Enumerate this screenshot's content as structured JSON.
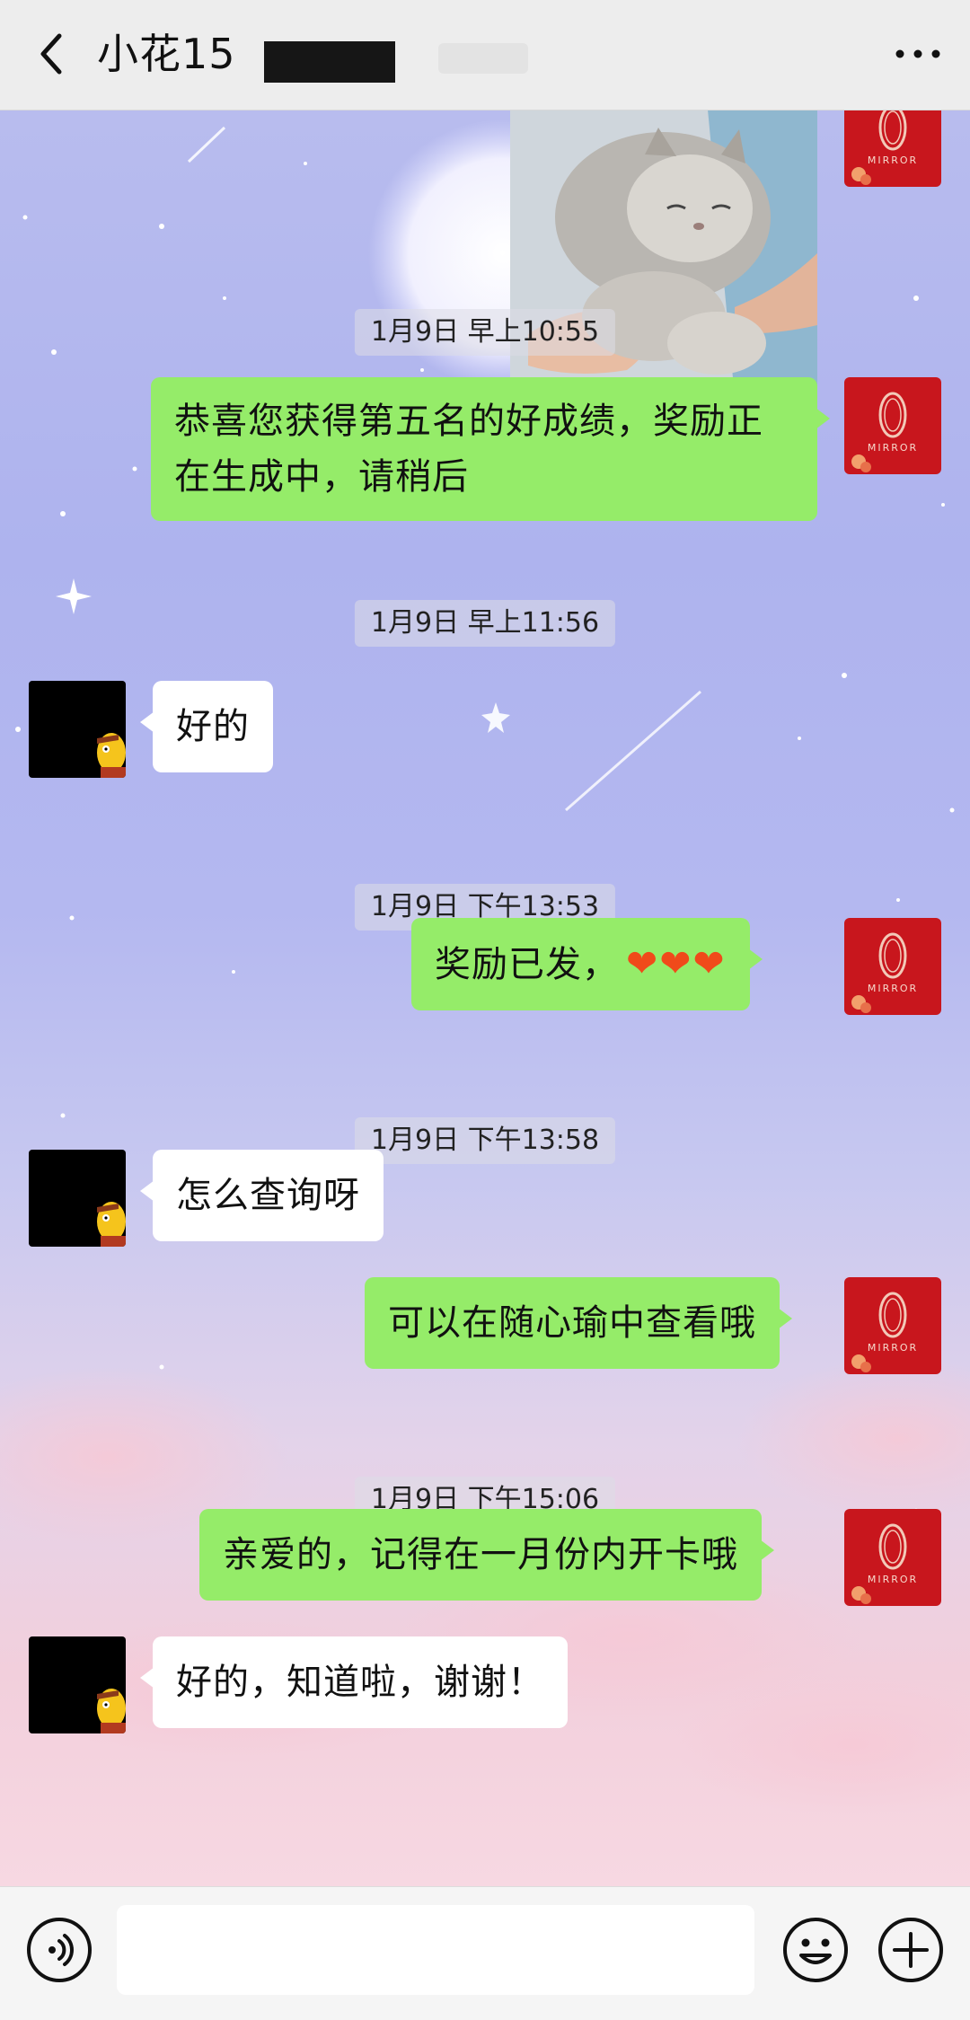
{
  "header": {
    "title": "小花15",
    "back_icon": "chevron-left-icon",
    "more_icon": "more-dots-icon"
  },
  "messages": [
    {
      "type": "image",
      "side": "right",
      "description_icon": "cat-photo"
    },
    {
      "type": "time",
      "text": "1月9日 早上10:55"
    },
    {
      "type": "text",
      "side": "right",
      "text": "恭喜您获得第五名的好成绩，奖励正在生成中，请稍后"
    },
    {
      "type": "time",
      "text": "1月9日 早上11:56"
    },
    {
      "type": "text",
      "side": "left",
      "text": "好的"
    },
    {
      "type": "time",
      "text": "1月9日 下午13:53"
    },
    {
      "type": "text",
      "side": "right",
      "text": "奖励已发，",
      "emoji": "❤❤❤"
    },
    {
      "type": "time",
      "text": "1月9日 下午13:58"
    },
    {
      "type": "text",
      "side": "left",
      "text": "怎么查询呀"
    },
    {
      "type": "text",
      "side": "right",
      "text": "可以在随心瑜中查看哦"
    },
    {
      "type": "time",
      "text": "1月9日 下午15:06"
    },
    {
      "type": "text",
      "side": "right",
      "text": "亲爱的，记得在一月份内开卡哦"
    },
    {
      "type": "text",
      "side": "left",
      "text": "好的，知道啦，谢谢！"
    }
  ],
  "avatar_text": "MIRROR",
  "input": {
    "placeholder": ""
  },
  "colors": {
    "header_bg": "#ededed",
    "bubble_right": "#95ec69",
    "bubble_left": "#ffffff",
    "avatar_red": "#c8161d"
  }
}
